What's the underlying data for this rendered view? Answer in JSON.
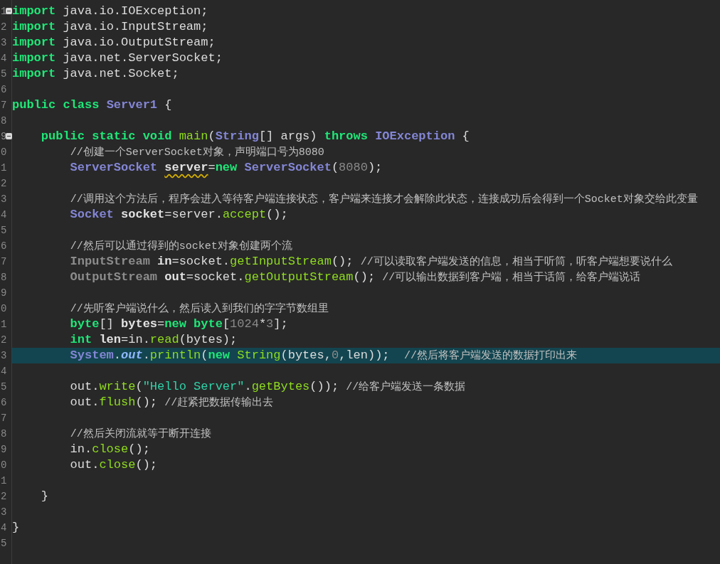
{
  "editor": {
    "lines": [
      {
        "number": "1",
        "folded": false,
        "current": false,
        "tokens": [
          {
            "kind": "keyword",
            "text": "import"
          },
          {
            "kind": "plain",
            "text": " java.io.IOException;"
          }
        ]
      },
      {
        "number": "2",
        "current": false,
        "tokens": [
          {
            "kind": "keyword",
            "text": "import"
          },
          {
            "kind": "plain",
            "text": " java.io.InputStream;"
          }
        ]
      },
      {
        "number": "3",
        "current": false,
        "tokens": [
          {
            "kind": "keyword",
            "text": "import"
          },
          {
            "kind": "plain",
            "text": " java.io.OutputStream;"
          }
        ]
      },
      {
        "number": "4",
        "current": false,
        "tokens": [
          {
            "kind": "keyword",
            "text": "import"
          },
          {
            "kind": "plain",
            "text": " java.net.ServerSocket;"
          }
        ]
      },
      {
        "number": "5",
        "current": false,
        "tokens": [
          {
            "kind": "keyword",
            "text": "import"
          },
          {
            "kind": "plain",
            "text": " java.net.Socket;"
          }
        ]
      },
      {
        "number": "6",
        "current": false
      },
      {
        "number": "7",
        "current": false,
        "tokens": [
          {
            "kind": "keyword",
            "text": "public class "
          },
          {
            "kind": "type",
            "text": "Server1"
          },
          {
            "kind": "plain",
            "text": " {"
          }
        ]
      },
      {
        "number": "8",
        "current": false
      },
      {
        "number": "9",
        "folded": false,
        "current": false,
        "tokens": [
          {
            "kind": "keyword",
            "text": "    public static void "
          },
          {
            "kind": "method",
            "text": "main"
          },
          {
            "kind": "plain",
            "text": "("
          },
          {
            "kind": "type",
            "text": "String"
          },
          {
            "kind": "plain",
            "text": "[] args) "
          },
          {
            "kind": "keyword",
            "text": "throws "
          },
          {
            "kind": "type",
            "text": "IOException"
          },
          {
            "kind": "plain",
            "text": " {"
          }
        ]
      },
      {
        "number": "0",
        "current": false,
        "tokens": [
          {
            "kind": "comment",
            "text": "        //创建一个ServerSocket对象，声明端口号为8080"
          }
        ]
      },
      {
        "number": "1",
        "current": false,
        "tokens": [
          {
            "kind": "type",
            "text": "        ServerSocket "
          },
          {
            "kind": "local",
            "text": "server",
            "warning": true
          },
          {
            "kind": "plain",
            "text": "="
          },
          {
            "kind": "keyword",
            "text": "new "
          },
          {
            "kind": "type",
            "text": "ServerSocket"
          },
          {
            "kind": "plain",
            "text": "("
          },
          {
            "kind": "number",
            "text": "8080"
          },
          {
            "kind": "plain",
            "text": ");"
          }
        ]
      },
      {
        "number": "2",
        "current": false
      },
      {
        "number": "3",
        "current": false,
        "tokens": [
          {
            "kind": "comment",
            "text": "        //调用这个方法后，程序会进入等待客户端连接状态，客户端来连接才会解除此状态，连接成功后会得到一个Socket对象交给此变量"
          }
        ]
      },
      {
        "number": "4",
        "current": false,
        "tokens": [
          {
            "kind": "type",
            "text": "        Socket "
          },
          {
            "kind": "local",
            "text": "socket"
          },
          {
            "kind": "plain",
            "text": "=server."
          },
          {
            "kind": "method",
            "text": "accept"
          },
          {
            "kind": "plain",
            "text": "();"
          }
        ]
      },
      {
        "number": "5",
        "current": false
      },
      {
        "number": "6",
        "current": false,
        "tokens": [
          {
            "kind": "comment",
            "text": "        //然后可以通过得到的socket对象创建两个流"
          }
        ]
      },
      {
        "number": "7",
        "current": false,
        "tokens": [
          {
            "kind": "type_dim",
            "text": "        InputStream "
          },
          {
            "kind": "local",
            "text": "in"
          },
          {
            "kind": "plain",
            "text": "=socket."
          },
          {
            "kind": "method",
            "text": "getInputStream"
          },
          {
            "kind": "plain",
            "text": "(); "
          },
          {
            "kind": "comment",
            "text": "//可以读取客户端发送的信息，相当于听筒，听客户端想要说什么"
          }
        ]
      },
      {
        "number": "8",
        "current": false,
        "tokens": [
          {
            "kind": "type_dim",
            "text": "        OutputStream "
          },
          {
            "kind": "local",
            "text": "out"
          },
          {
            "kind": "plain",
            "text": "=socket."
          },
          {
            "kind": "method",
            "text": "getOutputStream"
          },
          {
            "kind": "plain",
            "text": "(); "
          },
          {
            "kind": "comment",
            "text": "//可以输出数据到客户端，相当于话筒，给客户端说话"
          }
        ]
      },
      {
        "number": "9",
        "current": false
      },
      {
        "number": "0",
        "current": false,
        "tokens": [
          {
            "kind": "comment",
            "text": "        //先听客户端说什么，然后读入到我们的字字节数组里"
          }
        ]
      },
      {
        "number": "1",
        "current": false,
        "tokens": [
          {
            "kind": "keyword",
            "text": "        byte"
          },
          {
            "kind": "plain",
            "text": "[] "
          },
          {
            "kind": "local",
            "text": "bytes"
          },
          {
            "kind": "plain",
            "text": "="
          },
          {
            "kind": "keyword",
            "text": "new byte"
          },
          {
            "kind": "plain",
            "text": "["
          },
          {
            "kind": "number",
            "text": "1024"
          },
          {
            "kind": "plain",
            "text": "*"
          },
          {
            "kind": "number",
            "text": "3"
          },
          {
            "kind": "plain",
            "text": "];"
          }
        ]
      },
      {
        "number": "2",
        "current": false,
        "tokens": [
          {
            "kind": "keyword",
            "text": "        int "
          },
          {
            "kind": "local",
            "text": "len"
          },
          {
            "kind": "plain",
            "text": "=in."
          },
          {
            "kind": "method",
            "text": "read"
          },
          {
            "kind": "plain",
            "text": "(bytes);"
          }
        ]
      },
      {
        "number": "3",
        "current": true,
        "tokens": [
          {
            "kind": "type",
            "text": "        System"
          },
          {
            "kind": "plain",
            "text": "."
          },
          {
            "kind": "static_field",
            "text": "out"
          },
          {
            "kind": "plain",
            "text": "."
          },
          {
            "kind": "method",
            "text": "println"
          },
          {
            "kind": "plain",
            "text": "("
          },
          {
            "kind": "keyword",
            "text": "new "
          },
          {
            "kind": "method",
            "text": "String"
          },
          {
            "kind": "plain",
            "text": "(bytes,"
          },
          {
            "kind": "number",
            "text": "0"
          },
          {
            "kind": "plain",
            "text": ",len));  "
          },
          {
            "kind": "comment",
            "text": "//然后将客户端发送的数据打印出来"
          }
        ]
      },
      {
        "number": "4",
        "current": false
      },
      {
        "number": "5",
        "current": false,
        "tokens": [
          {
            "kind": "plain",
            "text": "        out."
          },
          {
            "kind": "method",
            "text": "write"
          },
          {
            "kind": "plain",
            "text": "("
          },
          {
            "kind": "string",
            "text": "\"Hello Server\""
          },
          {
            "kind": "plain",
            "text": "."
          },
          {
            "kind": "method",
            "text": "getBytes"
          },
          {
            "kind": "plain",
            "text": "()); "
          },
          {
            "kind": "comment",
            "text": "//给客户端发送一条数据"
          }
        ]
      },
      {
        "number": "6",
        "current": false,
        "tokens": [
          {
            "kind": "plain",
            "text": "        out."
          },
          {
            "kind": "method",
            "text": "flush"
          },
          {
            "kind": "plain",
            "text": "(); "
          },
          {
            "kind": "comment",
            "text": "//赶紧把数据传输出去"
          }
        ]
      },
      {
        "number": "7",
        "current": false
      },
      {
        "number": "8",
        "current": false,
        "tokens": [
          {
            "kind": "comment",
            "text": "        //然后关闭流就等于断开连接"
          }
        ]
      },
      {
        "number": "9",
        "current": false,
        "tokens": [
          {
            "kind": "plain",
            "text": "        in."
          },
          {
            "kind": "method",
            "text": "close"
          },
          {
            "kind": "plain",
            "text": "();"
          }
        ]
      },
      {
        "number": "0",
        "current": false,
        "tokens": [
          {
            "kind": "plain",
            "text": "        out."
          },
          {
            "kind": "method",
            "text": "close"
          },
          {
            "kind": "plain",
            "text": "();"
          }
        ]
      },
      {
        "number": "1",
        "current": false
      },
      {
        "number": "2",
        "current": false,
        "tokens": [
          {
            "kind": "plain",
            "text": "    }"
          }
        ]
      },
      {
        "number": "3",
        "current": false
      },
      {
        "number": "4",
        "current": false,
        "tokens": [
          {
            "kind": "plain",
            "text": "}"
          }
        ]
      },
      {
        "number": "5",
        "current": false
      }
    ]
  }
}
